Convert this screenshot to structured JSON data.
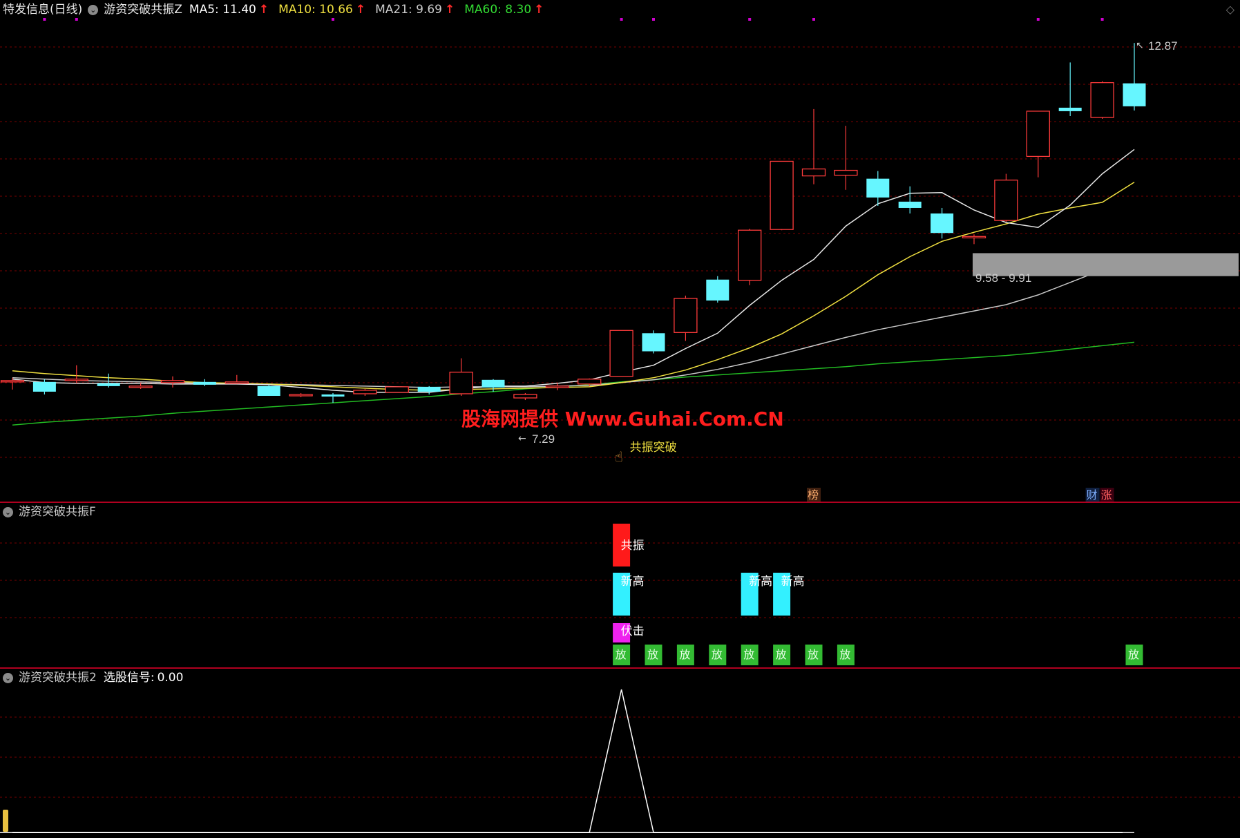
{
  "colors": {
    "up": "#ff3b3b",
    "down": "#66f6ff",
    "ma5": "#e6e6e6",
    "ma10": "#f0e040",
    "ma21": "#c8c8c8",
    "ma60": "#22bb22",
    "grid": "#7a0000",
    "divider": "#b00020",
    "watermark": "#ff1e1e",
    "signal_resonance": "#ff1a1a",
    "signal_newhigh": "#33f0ff",
    "signal_ambush": "#ee22ee",
    "signal_release": "#33bb33",
    "gray_zone": "#9a9a9a"
  },
  "main_panel": {
    "title": "特发信息(日线)",
    "indicator": "游资突破共振Z",
    "ma": [
      {
        "label": "MA5: 11.40",
        "color": "#ffffff"
      },
      {
        "label": "MA10: 10.66",
        "color": "#f0e040"
      },
      {
        "label": "MA21: 9.69",
        "color": "#cccccc"
      },
      {
        "label": "MA60: 8.30",
        "color": "#33dd33"
      }
    ],
    "up_arrow": "↑",
    "collapse_icon": "⌄",
    "corner_icon": "◇",
    "high_label": "12.87",
    "low_label": "7.29",
    "zone_label": "9.58 - 9.91",
    "breakout_label": "共振突破",
    "watermark": "股海网提供 Www.Guhai.Com.CN",
    "badge_rank": "榜",
    "badge_finance": "财",
    "badge_rise": "涨"
  },
  "sub_panel_f": {
    "title": "游资突破共振F",
    "resonance": "共振",
    "newhigh": "新高",
    "ambush": "伏击",
    "release": "放"
  },
  "sub_panel_2": {
    "title": "游资突破共振2",
    "signal_label": "选股信号:",
    "signal_value": "0.00"
  },
  "chart_data": {
    "type": "candlestick",
    "ylim": [
      6.5,
      13.2
    ],
    "grid": true,
    "ohlc": [
      {
        "o": 8.08,
        "h": 8.12,
        "l": 7.95,
        "c": 8.08,
        "dir": "up"
      },
      {
        "o": 8.06,
        "h": 8.1,
        "l": 7.88,
        "c": 7.92,
        "dir": "down"
      },
      {
        "o": 8.08,
        "h": 8.3,
        "l": 8.04,
        "c": 8.1,
        "dir": "up"
      },
      {
        "o": 8.04,
        "h": 8.18,
        "l": 7.98,
        "c": 8.0,
        "dir": "down"
      },
      {
        "o": 8.0,
        "h": 8.04,
        "l": 7.96,
        "c": 7.98,
        "dir": "up"
      },
      {
        "o": 8.05,
        "h": 8.14,
        "l": 7.98,
        "c": 8.08,
        "dir": "up"
      },
      {
        "o": 8.06,
        "h": 8.1,
        "l": 8.0,
        "c": 8.02,
        "dir": "down"
      },
      {
        "o": 8.06,
        "h": 8.16,
        "l": 8.04,
        "c": 8.04,
        "dir": "up"
      },
      {
        "o": 8.0,
        "h": 8.02,
        "l": 7.86,
        "c": 7.86,
        "dir": "down"
      },
      {
        "o": 7.86,
        "h": 7.9,
        "l": 7.84,
        "c": 7.88,
        "dir": "up"
      },
      {
        "o": 7.88,
        "h": 7.9,
        "l": 7.76,
        "c": 7.85,
        "dir": "down"
      },
      {
        "o": 7.89,
        "h": 7.96,
        "l": 7.86,
        "c": 7.94,
        "dir": "up"
      },
      {
        "o": 7.91,
        "h": 7.99,
        "l": 7.91,
        "c": 7.99,
        "dir": "up"
      },
      {
        "o": 7.99,
        "h": 8.0,
        "l": 7.88,
        "c": 7.92,
        "dir": "down"
      },
      {
        "o": 7.89,
        "h": 8.4,
        "l": 7.86,
        "c": 8.2,
        "dir": "up"
      },
      {
        "o": 8.09,
        "h": 8.1,
        "l": 7.92,
        "c": 7.98,
        "dir": "down"
      },
      {
        "o": 7.83,
        "h": 7.9,
        "l": 7.8,
        "c": 7.88,
        "dir": "up"
      },
      {
        "o": 7.98,
        "h": 8.04,
        "l": 7.94,
        "c": 8.0,
        "dir": "up"
      },
      {
        "o": 8.03,
        "h": 8.11,
        "l": 8.0,
        "c": 8.1,
        "dir": "up"
      },
      {
        "o": 8.14,
        "h": 8.8,
        "l": 8.14,
        "c": 8.8,
        "dir": "up"
      },
      {
        "o": 8.76,
        "h": 8.8,
        "l": 8.47,
        "c": 8.5,
        "dir": "down"
      },
      {
        "o": 8.77,
        "h": 9.3,
        "l": 8.65,
        "c": 9.26,
        "dir": "up"
      },
      {
        "o": 9.53,
        "h": 9.58,
        "l": 9.2,
        "c": 9.23,
        "dir": "down"
      },
      {
        "o": 9.52,
        "h": 10.26,
        "l": 9.45,
        "c": 10.24,
        "dir": "up"
      },
      {
        "o": 10.25,
        "h": 11.23,
        "l": 10.24,
        "c": 11.23,
        "dir": "up"
      },
      {
        "o": 11.02,
        "h": 11.98,
        "l": 10.9,
        "c": 11.12,
        "dir": "up"
      },
      {
        "o": 11.03,
        "h": 11.74,
        "l": 10.82,
        "c": 11.1,
        "dir": "up"
      },
      {
        "o": 10.98,
        "h": 11.09,
        "l": 10.59,
        "c": 10.71,
        "dir": "down"
      },
      {
        "o": 10.65,
        "h": 10.87,
        "l": 10.48,
        "c": 10.56,
        "dir": "down"
      },
      {
        "o": 10.48,
        "h": 10.56,
        "l": 10.12,
        "c": 10.2,
        "dir": "down"
      },
      {
        "o": 10.14,
        "h": 10.18,
        "l": 10.04,
        "c": 10.15,
        "dir": "up"
      },
      {
        "o": 10.38,
        "h": 11.05,
        "l": 10.36,
        "c": 10.96,
        "dir": "up"
      },
      {
        "o": 11.3,
        "h": 11.9,
        "l": 11.0,
        "c": 11.95,
        "dir": "up"
      },
      {
        "o": 11.95,
        "h": 12.65,
        "l": 11.88,
        "c": 12.0,
        "dir": "down"
      },
      {
        "o": 11.86,
        "h": 12.38,
        "l": 11.84,
        "c": 12.36,
        "dir": "up"
      },
      {
        "o": 12.35,
        "h": 12.93,
        "l": 11.96,
        "c": 12.02,
        "dir": "down"
      }
    ],
    "ma5": [
      8.1,
      8.05,
      8.04,
      8.04,
      8.04,
      8.03,
      8.03,
      8.03,
      8.02,
      7.98,
      7.94,
      7.91,
      7.91,
      7.91,
      7.96,
      8.0,
      8.0,
      8.04,
      8.09,
      8.2,
      8.3,
      8.54,
      8.76,
      9.16,
      9.52,
      9.82,
      10.3,
      10.62,
      10.77,
      10.78,
      10.53,
      10.35,
      10.28,
      10.6,
      11.05,
      11.4
    ],
    "ma10": [
      8.22,
      8.18,
      8.15,
      8.12,
      8.1,
      8.07,
      8.05,
      8.04,
      8.03,
      8.01,
      7.99,
      7.97,
      7.95,
      7.94,
      7.95,
      7.96,
      7.97,
      7.98,
      7.99,
      8.05,
      8.12,
      8.23,
      8.38,
      8.55,
      8.75,
      9.01,
      9.29,
      9.6,
      9.86,
      10.08,
      10.21,
      10.33,
      10.47,
      10.56,
      10.64,
      10.93
    ],
    "ma21": [
      8.12,
      8.1,
      8.08,
      8.07,
      8.06,
      8.05,
      8.04,
      8.04,
      8.03,
      8.02,
      8.01,
      8.0,
      7.99,
      7.98,
      7.99,
      7.99,
      7.99,
      8.0,
      8.01,
      8.05,
      8.09,
      8.16,
      8.24,
      8.34,
      8.46,
      8.58,
      8.7,
      8.81,
      8.9,
      8.99,
      9.08,
      9.17,
      9.31,
      9.49,
      9.67,
      9.69
    ],
    "ma60": [
      7.44,
      7.48,
      7.51,
      7.54,
      7.57,
      7.61,
      7.64,
      7.67,
      7.7,
      7.73,
      7.76,
      7.79,
      7.82,
      7.85,
      7.89,
      7.92,
      7.96,
      7.99,
      8.02,
      8.06,
      8.09,
      8.13,
      8.16,
      8.19,
      8.22,
      8.25,
      8.28,
      8.32,
      8.35,
      8.38,
      8.41,
      8.44,
      8.48,
      8.53,
      8.58,
      8.63
    ],
    "resonance_zone": [
      9.58,
      9.91
    ],
    "signals": {
      "resonance": [
        19
      ],
      "newhigh": [
        19,
        23,
        24
      ],
      "ambush": [
        19
      ],
      "release": [
        19,
        20,
        21,
        22,
        23,
        24,
        25,
        26,
        35
      ]
    },
    "selection_signal": [
      0,
      0,
      0,
      0,
      0,
      0,
      0,
      0,
      0,
      0,
      0,
      0,
      0,
      0,
      0,
      0,
      0,
      0,
      0,
      1,
      0,
      0,
      0,
      0,
      0,
      0,
      0,
      0,
      0,
      0,
      0,
      0,
      0,
      0,
      0,
      0
    ]
  }
}
